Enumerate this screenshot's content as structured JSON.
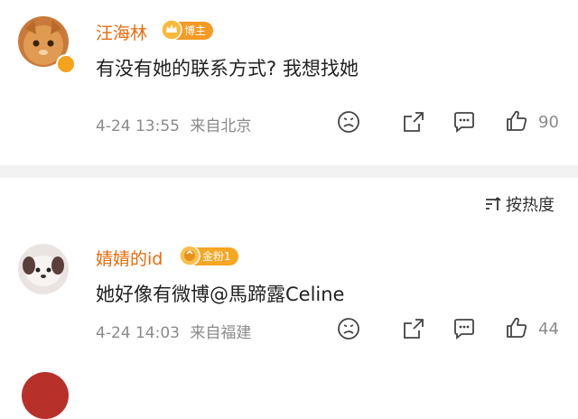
{
  "comments": [
    {
      "username": "汪海林",
      "badge": "博主",
      "text": "有没有她的联系方式? 我想找她",
      "date": "4-24 13:55",
      "location": "来自北京",
      "likes": "90"
    },
    {
      "username": "婧婧的id",
      "badge": "金粉1",
      "text": "她好像有微博@馬蹄露Celine",
      "date": "4-24 14:03",
      "location": "来自福建",
      "likes": "44"
    }
  ],
  "sort": {
    "label": "按热度"
  },
  "colors": {
    "username": "#e86b0c",
    "badge_blogger": "#f59a23",
    "badge_fan": "#f5a623",
    "meta": "#8a8a8a"
  }
}
